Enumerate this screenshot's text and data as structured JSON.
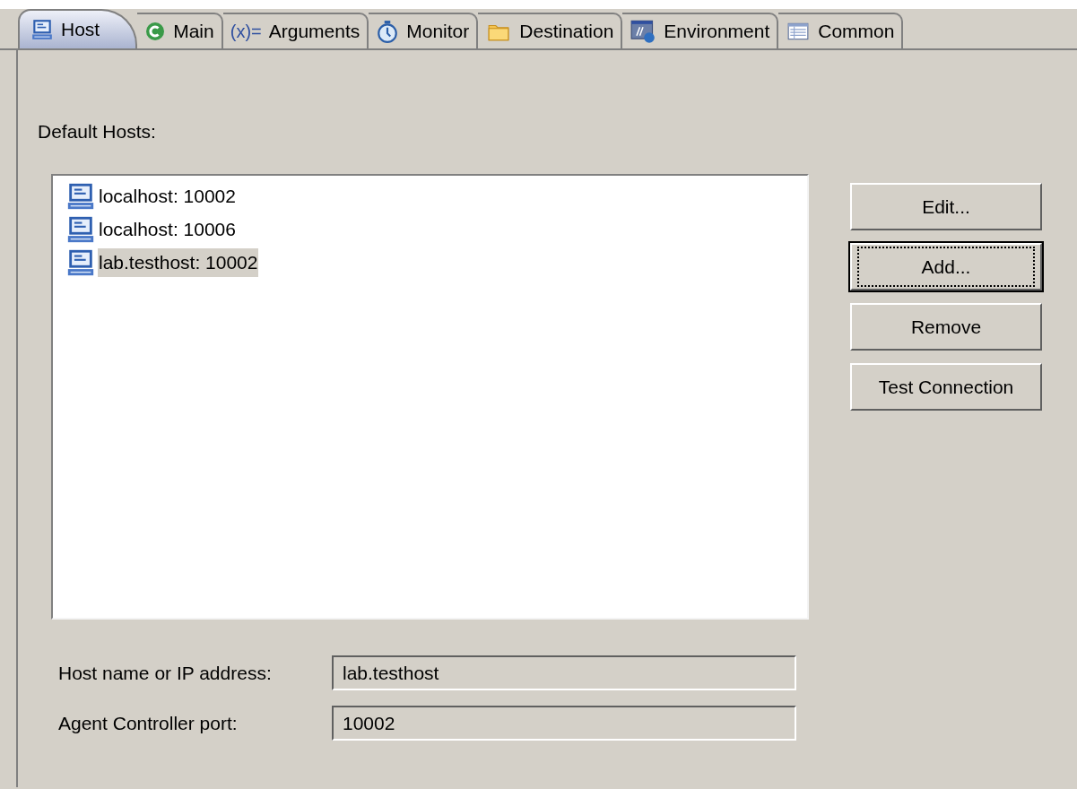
{
  "tabs": [
    {
      "kind": "host",
      "label": "Host",
      "selected": true
    },
    {
      "kind": "main",
      "label": "Main",
      "selected": false
    },
    {
      "kind": "arguments",
      "icon_text": "(x)=",
      "label": "Arguments",
      "selected": false
    },
    {
      "kind": "monitor",
      "label": "Monitor",
      "selected": false
    },
    {
      "kind": "destination",
      "label": "Destination",
      "selected": false
    },
    {
      "kind": "environment",
      "label": "Environment",
      "selected": false
    },
    {
      "kind": "common",
      "label": "Common",
      "selected": false
    }
  ],
  "default_hosts": {
    "label": "Default Hosts:",
    "items": [
      {
        "label": "localhost: 10002",
        "selected": false
      },
      {
        "label": "localhost: 10006",
        "selected": false
      },
      {
        "label": "lab.testhost: 10002",
        "selected": true
      }
    ]
  },
  "buttons": [
    {
      "label": "Edit...",
      "focused": false
    },
    {
      "label": "Add...",
      "focused": true
    },
    {
      "label": "Remove",
      "focused": false
    },
    {
      "label": "Test Connection",
      "focused": false
    }
  ],
  "fields": [
    {
      "label": "Host name or IP address:",
      "value": "lab.testhost",
      "disabled": true
    },
    {
      "label": "Agent Controller port:",
      "value": "10002",
      "disabled": true
    }
  ]
}
